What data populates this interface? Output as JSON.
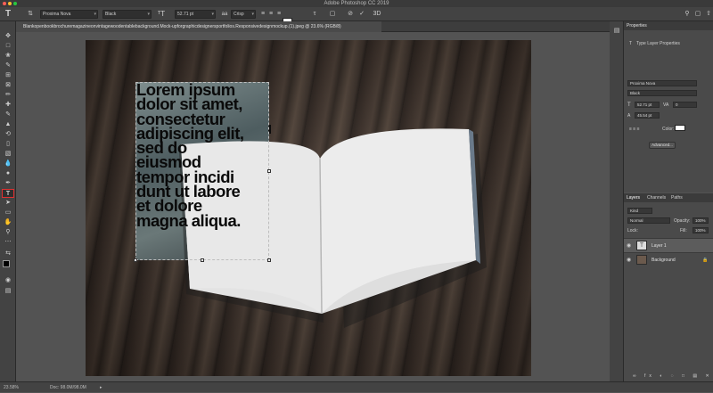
{
  "window": {
    "title": "Adobe Photoshop CC 2019",
    "traffic_colors": [
      "#ff5f57",
      "#febc2e",
      "#28c840"
    ]
  },
  "options_bar": {
    "font_family": "Proxima Nova",
    "font_style": "Black",
    "font_size": "52.71 pt",
    "antialias": "Crisp",
    "text_color": "#ffffff"
  },
  "document": {
    "tab_title": "Blankopenbookbrochuremagazineonvintagewoodentablebackground.Mock-upforgraphicdesignersportfolios.Responsivedesignmockup.(1).jpeg @ 23.6% (RGB/8)",
    "layer_text": "Lorem ipsum\ndolor sit amet,\nconsectetur\nadipiscing elit,\nsed do\neiusmod\ntempor incidi\ndunt ut labore\net dolore\nmagna aliqua."
  },
  "status_bar": {
    "zoom": "23.58%",
    "doc_size": "Doc: 98.0M/98.0M"
  },
  "properties_panel": {
    "header": "Properties",
    "section_title": "Type Layer Properties",
    "font_family": "Proxima Nova",
    "font_style": "Black",
    "font_size": "52.71 pt",
    "leading": "45.54 pt",
    "tracking": "0",
    "color_label": "Color:",
    "color_value": "#ffffff",
    "advanced_label": "Advanced..."
  },
  "layers_panel": {
    "tabs": [
      "Layers",
      "Channels",
      "Paths"
    ],
    "filter_kind": "Kind",
    "blend_mode": "Normal",
    "opacity_label": "Opacity:",
    "opacity_value": "100%",
    "lock_label": "Lock:",
    "fill_label": "Fill:",
    "fill_value": "100%",
    "layers": [
      {
        "name": "Layer 1",
        "type": "text",
        "selected": true
      },
      {
        "name": "Background",
        "type": "image",
        "selected": false
      }
    ]
  },
  "icons": {
    "move": "move-tool-icon",
    "type": "type-tool-icon"
  }
}
